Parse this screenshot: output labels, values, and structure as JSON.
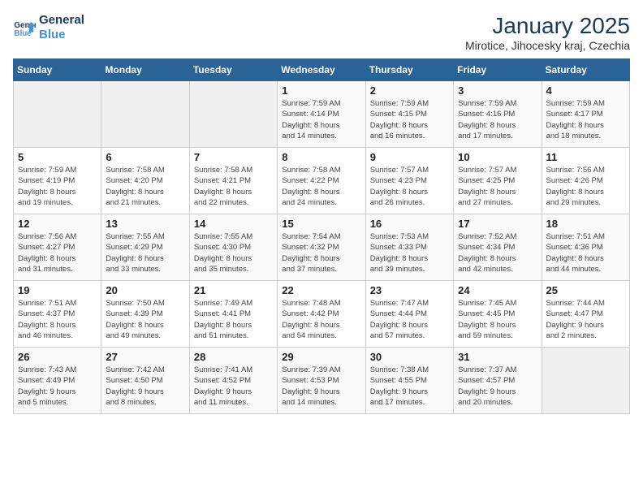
{
  "logo": {
    "line1": "General",
    "line2": "Blue"
  },
  "title": "January 2025",
  "subtitle": "Mirotice, Jihocesky kraj, Czechia",
  "days_of_week": [
    "Sunday",
    "Monday",
    "Tuesday",
    "Wednesday",
    "Thursday",
    "Friday",
    "Saturday"
  ],
  "weeks": [
    [
      {
        "day": "",
        "content": ""
      },
      {
        "day": "",
        "content": ""
      },
      {
        "day": "",
        "content": ""
      },
      {
        "day": "1",
        "content": "Sunrise: 7:59 AM\nSunset: 4:14 PM\nDaylight: 8 hours\nand 14 minutes."
      },
      {
        "day": "2",
        "content": "Sunrise: 7:59 AM\nSunset: 4:15 PM\nDaylight: 8 hours\nand 16 minutes."
      },
      {
        "day": "3",
        "content": "Sunrise: 7:59 AM\nSunset: 4:16 PM\nDaylight: 8 hours\nand 17 minutes."
      },
      {
        "day": "4",
        "content": "Sunrise: 7:59 AM\nSunset: 4:17 PM\nDaylight: 8 hours\nand 18 minutes."
      }
    ],
    [
      {
        "day": "5",
        "content": "Sunrise: 7:59 AM\nSunset: 4:19 PM\nDaylight: 8 hours\nand 19 minutes."
      },
      {
        "day": "6",
        "content": "Sunrise: 7:58 AM\nSunset: 4:20 PM\nDaylight: 8 hours\nand 21 minutes."
      },
      {
        "day": "7",
        "content": "Sunrise: 7:58 AM\nSunset: 4:21 PM\nDaylight: 8 hours\nand 22 minutes."
      },
      {
        "day": "8",
        "content": "Sunrise: 7:58 AM\nSunset: 4:22 PM\nDaylight: 8 hours\nand 24 minutes."
      },
      {
        "day": "9",
        "content": "Sunrise: 7:57 AM\nSunset: 4:23 PM\nDaylight: 8 hours\nand 26 minutes."
      },
      {
        "day": "10",
        "content": "Sunrise: 7:57 AM\nSunset: 4:25 PM\nDaylight: 8 hours\nand 27 minutes."
      },
      {
        "day": "11",
        "content": "Sunrise: 7:56 AM\nSunset: 4:26 PM\nDaylight: 8 hours\nand 29 minutes."
      }
    ],
    [
      {
        "day": "12",
        "content": "Sunrise: 7:56 AM\nSunset: 4:27 PM\nDaylight: 8 hours\nand 31 minutes."
      },
      {
        "day": "13",
        "content": "Sunrise: 7:55 AM\nSunset: 4:29 PM\nDaylight: 8 hours\nand 33 minutes."
      },
      {
        "day": "14",
        "content": "Sunrise: 7:55 AM\nSunset: 4:30 PM\nDaylight: 8 hours\nand 35 minutes."
      },
      {
        "day": "15",
        "content": "Sunrise: 7:54 AM\nSunset: 4:32 PM\nDaylight: 8 hours\nand 37 minutes."
      },
      {
        "day": "16",
        "content": "Sunrise: 7:53 AM\nSunset: 4:33 PM\nDaylight: 8 hours\nand 39 minutes."
      },
      {
        "day": "17",
        "content": "Sunrise: 7:52 AM\nSunset: 4:34 PM\nDaylight: 8 hours\nand 42 minutes."
      },
      {
        "day": "18",
        "content": "Sunrise: 7:51 AM\nSunset: 4:36 PM\nDaylight: 8 hours\nand 44 minutes."
      }
    ],
    [
      {
        "day": "19",
        "content": "Sunrise: 7:51 AM\nSunset: 4:37 PM\nDaylight: 8 hours\nand 46 minutes."
      },
      {
        "day": "20",
        "content": "Sunrise: 7:50 AM\nSunset: 4:39 PM\nDaylight: 8 hours\nand 49 minutes."
      },
      {
        "day": "21",
        "content": "Sunrise: 7:49 AM\nSunset: 4:41 PM\nDaylight: 8 hours\nand 51 minutes."
      },
      {
        "day": "22",
        "content": "Sunrise: 7:48 AM\nSunset: 4:42 PM\nDaylight: 8 hours\nand 54 minutes."
      },
      {
        "day": "23",
        "content": "Sunrise: 7:47 AM\nSunset: 4:44 PM\nDaylight: 8 hours\nand 57 minutes."
      },
      {
        "day": "24",
        "content": "Sunrise: 7:45 AM\nSunset: 4:45 PM\nDaylight: 8 hours\nand 59 minutes."
      },
      {
        "day": "25",
        "content": "Sunrise: 7:44 AM\nSunset: 4:47 PM\nDaylight: 9 hours\nand 2 minutes."
      }
    ],
    [
      {
        "day": "26",
        "content": "Sunrise: 7:43 AM\nSunset: 4:49 PM\nDaylight: 9 hours\nand 5 minutes."
      },
      {
        "day": "27",
        "content": "Sunrise: 7:42 AM\nSunset: 4:50 PM\nDaylight: 9 hours\nand 8 minutes."
      },
      {
        "day": "28",
        "content": "Sunrise: 7:41 AM\nSunset: 4:52 PM\nDaylight: 9 hours\nand 11 minutes."
      },
      {
        "day": "29",
        "content": "Sunrise: 7:39 AM\nSunset: 4:53 PM\nDaylight: 9 hours\nand 14 minutes."
      },
      {
        "day": "30",
        "content": "Sunrise: 7:38 AM\nSunset: 4:55 PM\nDaylight: 9 hours\nand 17 minutes."
      },
      {
        "day": "31",
        "content": "Sunrise: 7:37 AM\nSunset: 4:57 PM\nDaylight: 9 hours\nand 20 minutes."
      },
      {
        "day": "",
        "content": ""
      }
    ]
  ]
}
